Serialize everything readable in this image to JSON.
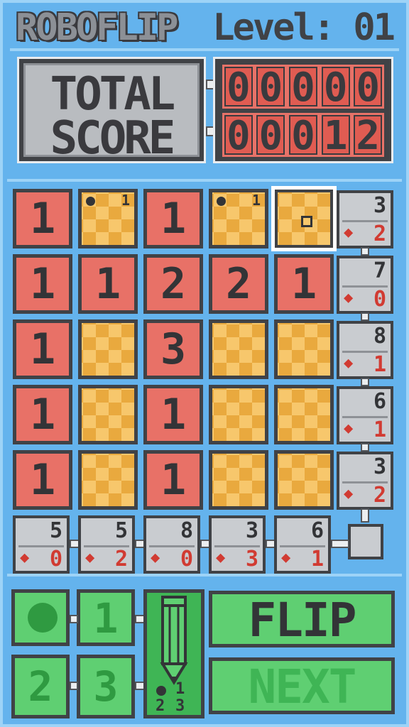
{
  "header": {
    "title": "ROBOFLIP",
    "level_label": "Level:",
    "level_value": "01"
  },
  "score": {
    "label_line1": "TOTAL",
    "label_line2": "SCORE",
    "total_digits": [
      "0",
      "0",
      "0",
      "0",
      "0"
    ],
    "current_digits": [
      "0",
      "0",
      "0",
      "1",
      "2"
    ]
  },
  "grid": {
    "tiles": [
      [
        {
          "state": "flipped",
          "value": "1"
        },
        {
          "state": "hidden",
          "memo": "1"
        },
        {
          "state": "flipped",
          "value": "1"
        },
        {
          "state": "hidden",
          "memo": "1"
        },
        {
          "state": "hidden",
          "selected": true
        }
      ],
      [
        {
          "state": "flipped",
          "value": "1"
        },
        {
          "state": "flipped",
          "value": "1"
        },
        {
          "state": "flipped",
          "value": "2"
        },
        {
          "state": "flipped",
          "value": "2"
        },
        {
          "state": "flipped",
          "value": "1"
        }
      ],
      [
        {
          "state": "flipped",
          "value": "1"
        },
        {
          "state": "hidden"
        },
        {
          "state": "flipped",
          "value": "3"
        },
        {
          "state": "hidden"
        },
        {
          "state": "hidden"
        }
      ],
      [
        {
          "state": "flipped",
          "value": "1"
        },
        {
          "state": "hidden"
        },
        {
          "state": "flipped",
          "value": "1"
        },
        {
          "state": "hidden"
        },
        {
          "state": "hidden"
        }
      ],
      [
        {
          "state": "flipped",
          "value": "1"
        },
        {
          "state": "hidden"
        },
        {
          "state": "flipped",
          "value": "1"
        },
        {
          "state": "hidden"
        },
        {
          "state": "hidden"
        }
      ]
    ],
    "row_hints": [
      {
        "sum": "3",
        "bombs": "2"
      },
      {
        "sum": "7",
        "bombs": "0"
      },
      {
        "sum": "8",
        "bombs": "1"
      },
      {
        "sum": "6",
        "bombs": "1"
      },
      {
        "sum": "3",
        "bombs": "2"
      }
    ],
    "col_hints": [
      {
        "sum": "5",
        "bombs": "0"
      },
      {
        "sum": "5",
        "bombs": "2"
      },
      {
        "sum": "8",
        "bombs": "0"
      },
      {
        "sum": "3",
        "bombs": "3"
      },
      {
        "sum": "6",
        "bombs": "1"
      }
    ]
  },
  "controls": {
    "memo_1": "1",
    "memo_2": "2",
    "memo_3": "3",
    "pencil_1": "1",
    "pencil_2": "2",
    "pencil_3": "3",
    "flip_label": "FLIP",
    "next_label": "NEXT"
  },
  "colors": {
    "background": "#64b3ed",
    "flipped_tile": "#e87167",
    "hidden_tile": "#f7c76c",
    "button_green": "#5fcf72",
    "hint_grey": "#c9ccd0",
    "bomb_red": "#d13b32"
  }
}
